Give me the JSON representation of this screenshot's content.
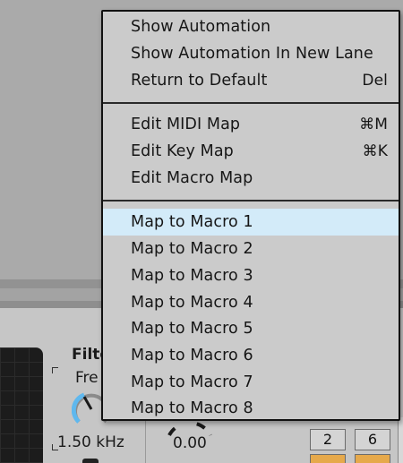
{
  "context_menu": {
    "group_automation": [
      {
        "label": "Show Automation",
        "shortcut": ""
      },
      {
        "label": "Show Automation In New Lane",
        "shortcut": ""
      },
      {
        "label": "Return to Default",
        "shortcut": "Del"
      }
    ],
    "group_mapping": [
      {
        "label": "Edit MIDI Map",
        "shortcut": "⌘M"
      },
      {
        "label": "Edit Key Map",
        "shortcut": "⌘K"
      },
      {
        "label": "Edit Macro Map",
        "shortcut": ""
      }
    ],
    "group_macros": [
      {
        "label": "Map to Macro 1",
        "highlighted": true
      },
      {
        "label": "Map to Macro 2"
      },
      {
        "label": "Map to Macro 3"
      },
      {
        "label": "Map to Macro 4"
      },
      {
        "label": "Map to Macro 5"
      },
      {
        "label": "Map to Macro 6"
      },
      {
        "label": "Map to Macro 7"
      },
      {
        "label": "Map to Macro 8"
      }
    ],
    "highlight_color": "#d3ebf9",
    "background_color": "#cbcbcb"
  },
  "device": {
    "filter_label": "Filte",
    "freq_label": "Fre",
    "freq_value": "1.50 kHz",
    "res_value": "0.00",
    "buttons": [
      "2",
      "6"
    ],
    "knob_accent_color": "#5fb8ee",
    "button_active_color": "#e6a94b"
  }
}
